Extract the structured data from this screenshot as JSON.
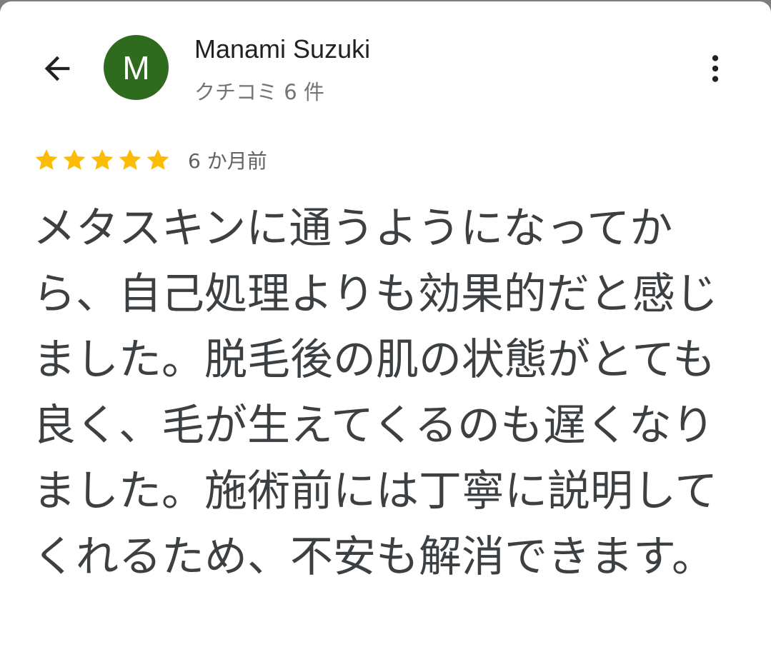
{
  "header": {
    "back_icon": "arrow-back-icon",
    "avatar": {
      "initial": "M",
      "color": "#2f6b1e"
    },
    "author_name": "Manami Suzuki",
    "review_count": "クチコミ 6 件",
    "more_icon": "more-vert-icon"
  },
  "review": {
    "rating": 5,
    "max_rating": 5,
    "star_color": "#fbbc04",
    "date": "6 か月前",
    "text": "メタスキンに通うようになってから、自己処理よりも効果的だと感じました。脱毛後の肌の状態がとても良く、毛が生えてくるのも遅くなりました。施術前には丁寧に説明してくれるため、不安も解消できます。"
  }
}
